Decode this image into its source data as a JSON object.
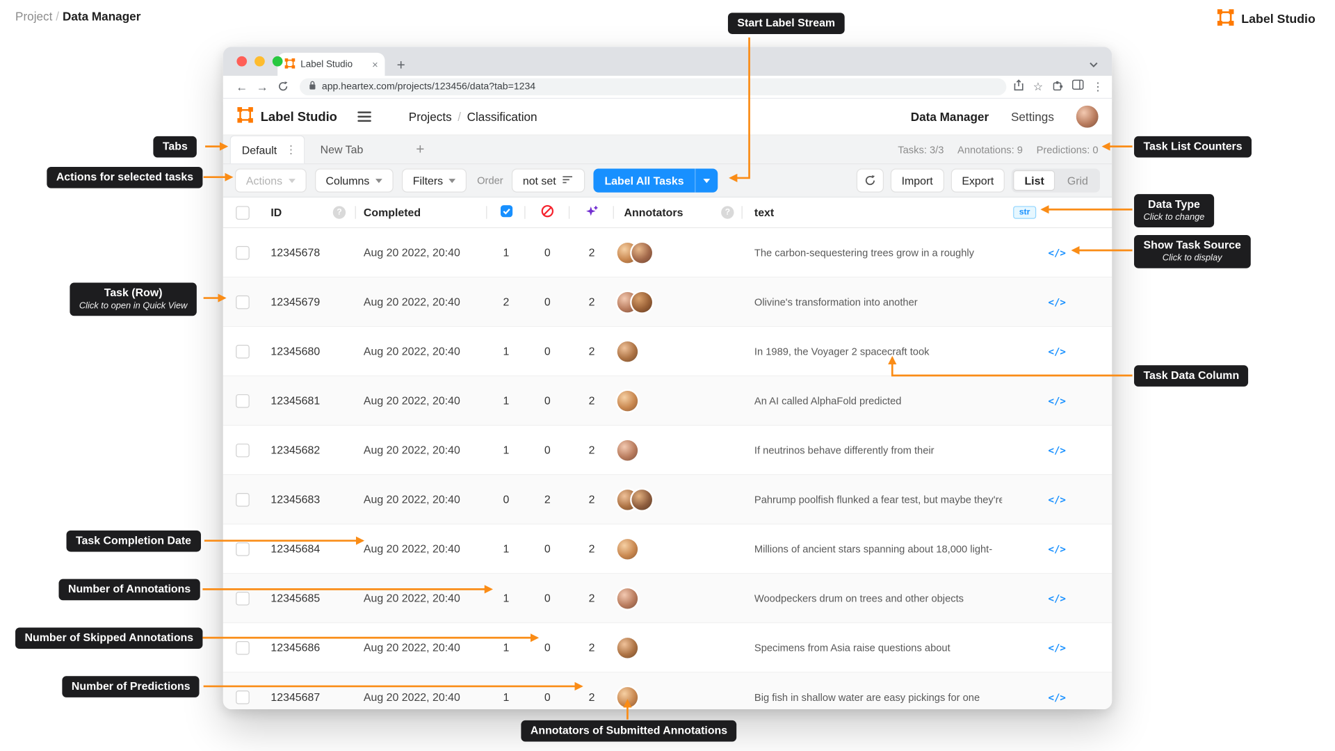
{
  "page": {
    "breadcrumb": {
      "section": "Project",
      "sep": "/",
      "current": "Data Manager"
    },
    "brand": "Label Studio"
  },
  "browser": {
    "tab_title": "Label Studio",
    "url": "app.heartex.com/projects/123456/data?tab=1234"
  },
  "header": {
    "app_name": "Label Studio",
    "breadcrumb": {
      "projects": "Projects",
      "sep": "/",
      "current": "Classification"
    },
    "nav_data_manager": "Data Manager",
    "nav_settings": "Settings"
  },
  "tabs": {
    "active": "Default",
    "new_tab": "New Tab",
    "counters": {
      "tasks": "Tasks: 3/3",
      "annotations": "Annotations: 9",
      "predictions": "Predictions: 0"
    }
  },
  "toolbar": {
    "actions": "Actions",
    "columns": "Columns",
    "filters": "Filters",
    "order_label": "Order",
    "order_value": "not set",
    "label_all_tasks": "Label All Tasks",
    "import": "Import",
    "export": "Export",
    "view_list": "List",
    "view_grid": "Grid"
  },
  "table": {
    "headers": {
      "id": "ID",
      "completed": "Completed",
      "annotators": "Annotators",
      "text": "text",
      "data_type_badge": "str"
    },
    "rows": [
      {
        "id": "12345678",
        "completed": "Aug 20 2022, 20:40",
        "annotations": "1",
        "skipped": "0",
        "predictions": "2",
        "annotators": 2,
        "text": "The carbon-sequestering trees grow in a roughly"
      },
      {
        "id": "12345679",
        "completed": "Aug 20 2022, 20:40",
        "annotations": "2",
        "skipped": "0",
        "predictions": "2",
        "annotators": 2,
        "text": "Olivine's transformation into another"
      },
      {
        "id": "12345680",
        "completed": "Aug 20 2022, 20:40",
        "annotations": "1",
        "skipped": "0",
        "predictions": "2",
        "annotators": 1,
        "text": "In 1989, the Voyager 2 spacecraft took"
      },
      {
        "id": "12345681",
        "completed": "Aug 20 2022, 20:40",
        "annotations": "1",
        "skipped": "0",
        "predictions": "2",
        "annotators": 1,
        "text": "An AI called AlphaFold predicted"
      },
      {
        "id": "12345682",
        "completed": "Aug 20 2022, 20:40",
        "annotations": "1",
        "skipped": "0",
        "predictions": "2",
        "annotators": 1,
        "text": "If neutrinos behave differently from their"
      },
      {
        "id": "12345683",
        "completed": "Aug 20 2022, 20:40",
        "annotations": "0",
        "skipped": "2",
        "predictions": "2",
        "annotators": 2,
        "text": "Pahrump poolfish flunked a fear test, but maybe they're"
      },
      {
        "id": "12345684",
        "completed": "Aug 20 2022, 20:40",
        "annotations": "1",
        "skipped": "0",
        "predictions": "2",
        "annotators": 1,
        "text": "Millions of ancient stars spanning about 18,000 light-"
      },
      {
        "id": "12345685",
        "completed": "Aug 20 2022, 20:40",
        "annotations": "1",
        "skipped": "0",
        "predictions": "2",
        "annotators": 1,
        "text": "Woodpeckers drum on trees and other objects"
      },
      {
        "id": "12345686",
        "completed": "Aug 20 2022, 20:40",
        "annotations": "1",
        "skipped": "0",
        "predictions": "2",
        "annotators": 1,
        "text": "Specimens from Asia raise questions about"
      },
      {
        "id": "12345687",
        "completed": "Aug 20 2022, 20:40",
        "annotations": "1",
        "skipped": "0",
        "predictions": "2",
        "annotators": 1,
        "text": "Big fish in shallow water are easy pickings for one"
      }
    ]
  },
  "callouts": {
    "start_label_stream": {
      "title": "Start Label Stream"
    },
    "tabs": {
      "title": "Tabs"
    },
    "actions": {
      "title": "Actions for selected tasks"
    },
    "task_list_counters": {
      "title": "Task List Counters"
    },
    "data_type": {
      "title": "Data Type",
      "subtitle": "Click to change"
    },
    "show_task_source": {
      "title": "Show Task Source",
      "subtitle": "Click to display"
    },
    "task_row": {
      "title": "Task (Row)",
      "subtitle": "Click to open in Quick View"
    },
    "task_data_column": {
      "title": "Task Data Column"
    },
    "task_completion_date": {
      "title": "Task Completion Date"
    },
    "number_of_annotations": {
      "title": "Number of Annotations"
    },
    "number_of_skipped": {
      "title": "Number of Skipped Annotations"
    },
    "number_of_predictions": {
      "title": "Number of Predictions"
    },
    "annotators_submitted": {
      "title": "Annotators of Submitted Annotations"
    }
  },
  "icons": {
    "help": "?",
    "code": "</>",
    "plus": "+",
    "close": "×",
    "kebab": "⋮",
    "star": "☆",
    "back": "←",
    "forward": "→"
  },
  "colors": {
    "accent_orange": "#fa8c16",
    "primary_blue": "#1890ff",
    "skip_red": "#f5222d",
    "prediction_purple": "#722ed1"
  }
}
